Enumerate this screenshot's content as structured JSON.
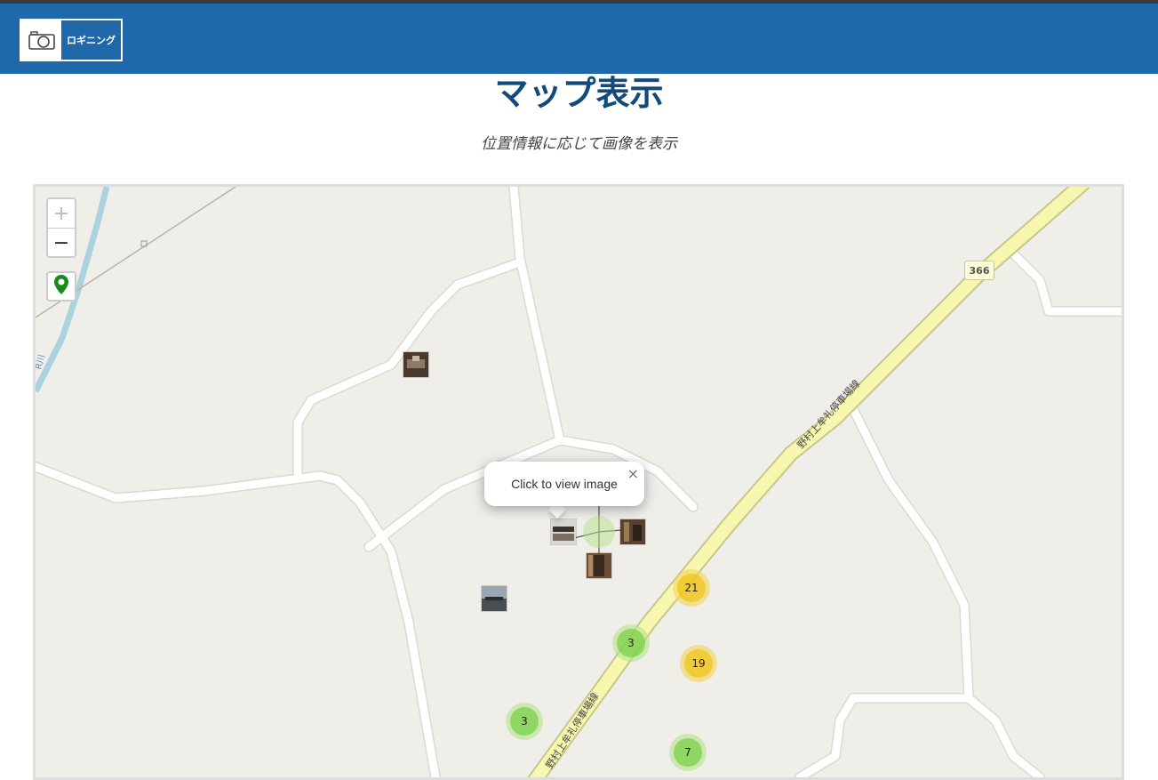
{
  "navbar": {
    "brand_text": "ロギニング",
    "brand_icon": "camera-icon",
    "color": "#1f69ab"
  },
  "page": {
    "title": "マップ表示",
    "subtitle": "位置情報に応じて画像を表示"
  },
  "map": {
    "zoom_in_label": "+",
    "zoom_out_label": "−",
    "locate_icon": "map-pin-icon",
    "popup_text": "Click to view image",
    "popup_close": "×",
    "road_number": "366",
    "road_name_upper": "野村上牟礼停車場線",
    "road_name_lower": "野村上牟礼停車場線",
    "river_label": "R川",
    "clusters": [
      {
        "count": "21",
        "level": "medium"
      },
      {
        "count": "3",
        "level": "small"
      },
      {
        "count": "19",
        "level": "medium"
      },
      {
        "count": "3",
        "level": "small"
      },
      {
        "count": "7",
        "level": "small"
      }
    ],
    "colors": {
      "land": "#f0eee9",
      "road_main": "#f7f7b0",
      "road_minor": "#ffffff",
      "water": "#aad3df",
      "cluster_small": "#6ecc39",
      "cluster_medium": "#f0c20c"
    }
  }
}
